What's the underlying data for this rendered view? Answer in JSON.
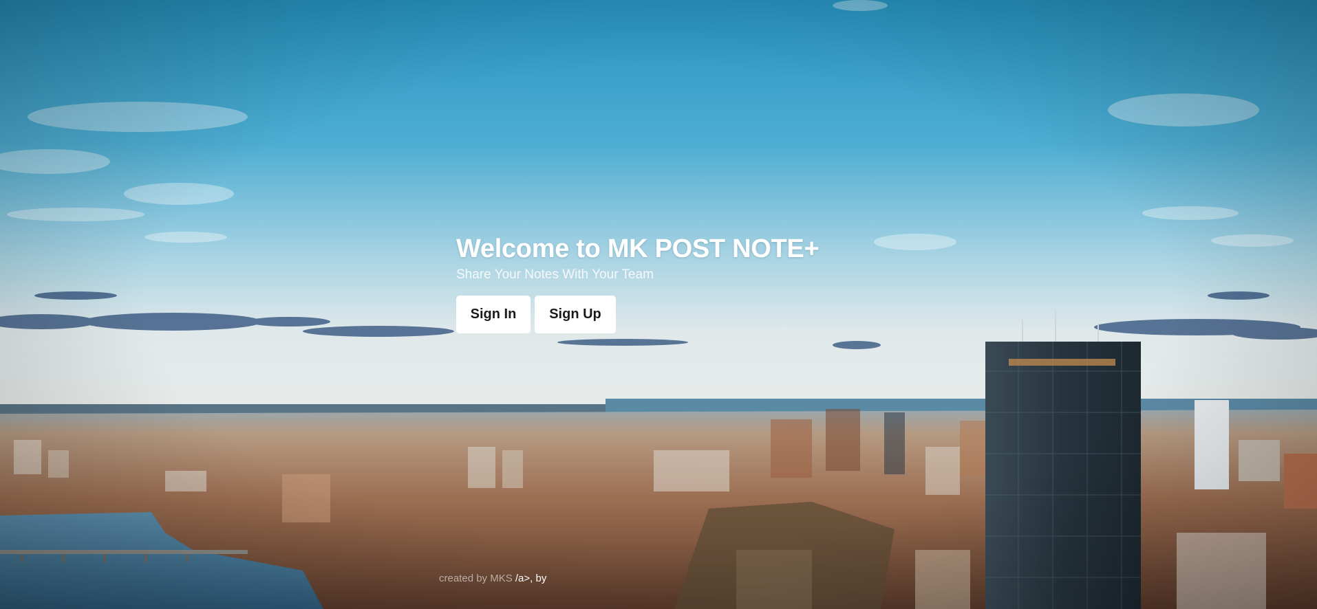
{
  "app": {
    "title": "Welcome to MK POST NOTE+",
    "subtitle": "Share Your Notes With Your Team"
  },
  "actions": {
    "sign_in_label": "Sign In",
    "sign_up_label": "Sign Up"
  },
  "footer": {
    "credit_faded": "created by MKS",
    "credit_lit": "/a>, by"
  },
  "background": {
    "description": "city-skyline-photo",
    "colors": {
      "sky_top": "#2f9fc8",
      "sky_mid": "#6bbbd8",
      "horizon": "#dfe7ea",
      "sea": "#4a86a6",
      "city": "#a8826a",
      "tower": "#2b3a44"
    }
  }
}
